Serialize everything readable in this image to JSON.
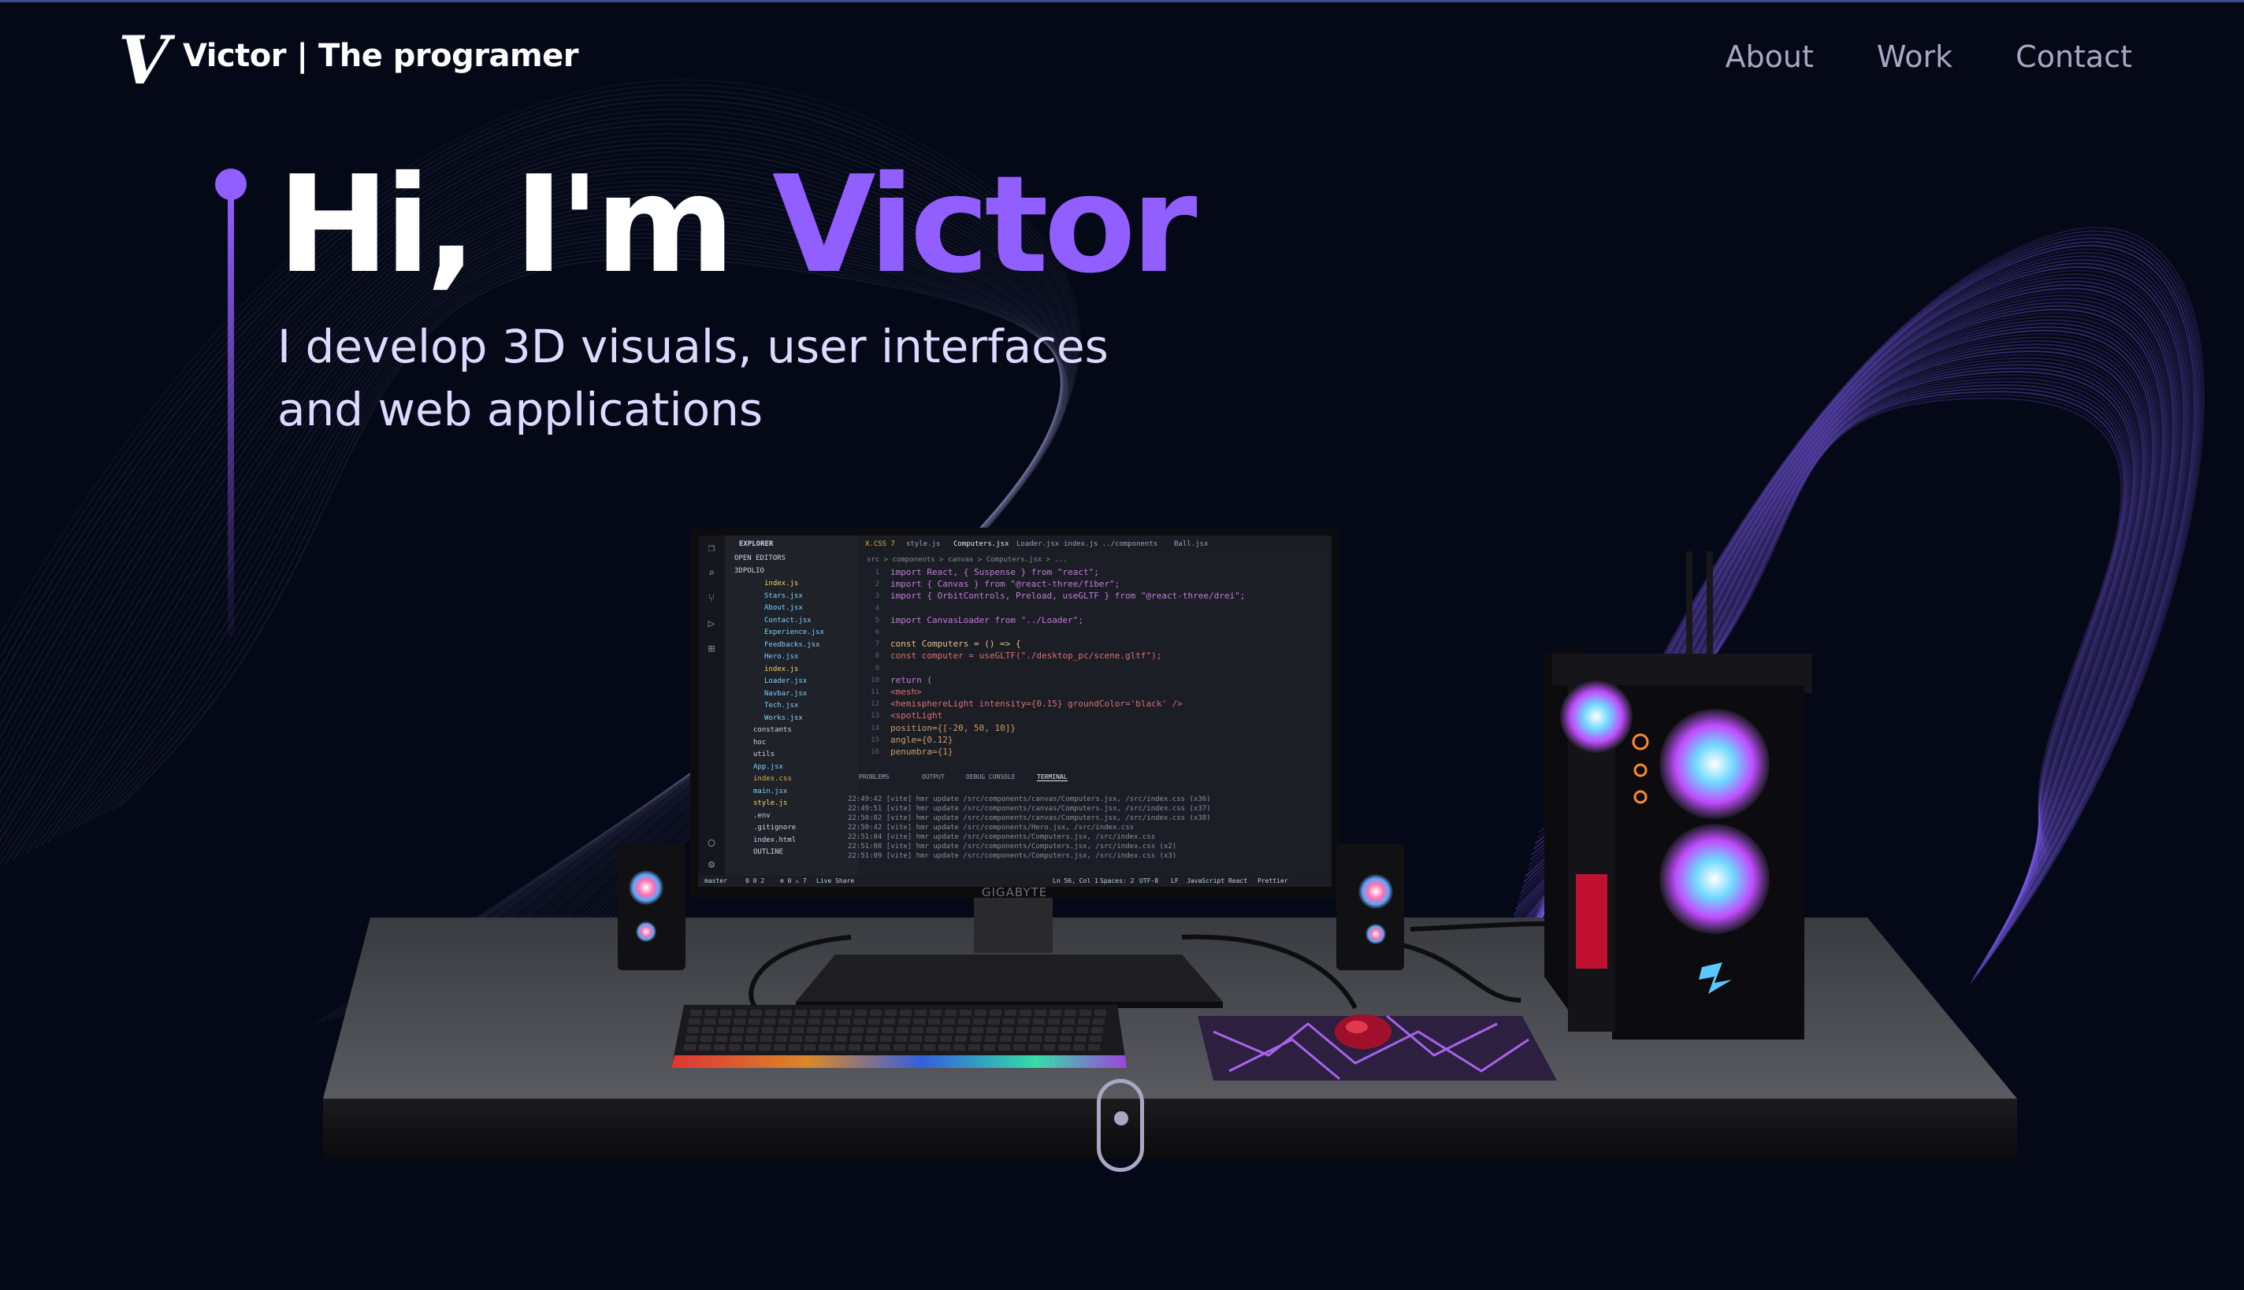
{
  "navbar": {
    "logo_letter": "V",
    "brand": "Victor  | The programer",
    "links": [
      "About",
      "Work",
      "Contact"
    ]
  },
  "hero": {
    "greeting": "Hi, I'm ",
    "name": "Victor",
    "subtitle": "I develop 3D visuals, user interfaces and web applications"
  },
  "monitor": {
    "brand": "GIGABYTE",
    "editor": {
      "explorer_title": "EXPLORER",
      "open_editors": "OPEN EDITORS",
      "project": "3DPOLIO",
      "tree": [
        "index.js",
        "Stars.jsx",
        "About.jsx",
        "Contact.jsx",
        "Experience.jsx",
        "Feedbacks.jsx",
        "Hero.jsx",
        "index.js",
        "Loader.jsx",
        "Navbar.jsx",
        "Tech.jsx",
        "Works.jsx",
        "constants",
        "hoc",
        "utils",
        "App.jsx",
        "index.css",
        "main.jsx",
        "style.js",
        ".env",
        ".gitignore",
        "index.html",
        "OUTLINE"
      ],
      "tabs": [
        "X.CSS 7",
        "style.js",
        "Computers.jsx",
        "Loader.jsx",
        "index.js ../components",
        "Ball.jsx"
      ],
      "breadcrumbs": "src > components > canvas > Computers.jsx > ...",
      "code": [
        "import React, { Suspense } from \"react\";",
        "import { Canvas } from \"@react-three/fiber\";",
        "import { OrbitControls, Preload, useGLTF } from \"@react-three/drei\";",
        "",
        "import CanvasLoader from \"../Loader\";",
        "",
        "const Computers = () => {",
        "  const computer = useGLTF(\"./desktop_pc/scene.gltf\");",
        "",
        "  return (",
        "    <mesh>",
        "      <hemisphereLight intensity={0.15} groundColor='black' />",
        "      <spotLight",
        "        position={[-20, 50, 10]}",
        "        angle={0.12}",
        "        penumbra={1}"
      ],
      "panel_tabs": [
        "PROBLEMS",
        "OUTPUT",
        "DEBUG CONSOLE",
        "TERMINAL"
      ],
      "terminal": [
        "22:49:42 [vite] hmr update /src/components/canvas/Computers.jsx, /src/index.css (x36)",
        "22:49:51 [vite] hmr update /src/components/canvas/Computers.jsx, /src/index.css (x37)",
        "22:50:02 [vite] hmr update /src/components/canvas/Computers.jsx, /src/index.css (x38)",
        "22:50:42 [vite] hmr update /src/components/Hero.jsx, /src/index.css",
        "22:51:04 [vite] hmr update /src/components/Computers.jsx, /src/index.css",
        "22:51:08 [vite] hmr update /src/components/Computers.jsx, /src/index.css (x2)",
        "22:51:09 [vite] hmr update /src/components/Computers.jsx, /src/index.css (x3)"
      ],
      "status_left": [
        "master",
        "0 0 2",
        "⊗ 0 ⚠ 7",
        "Live Share"
      ],
      "status_right": [
        "Ln 56, Col 1",
        "Spaces: 2",
        "UTF-8",
        "LF",
        "JavaScript React",
        "Prettier"
      ]
    }
  },
  "colors": {
    "background": "#050816",
    "accent": "#915eff",
    "nav_text": "#aaa6c3",
    "subtitle_text": "#dfd9ff"
  },
  "icons": [
    "scroll-indicator-icon",
    "explorer-icon",
    "search-icon",
    "source-control-icon",
    "debug-icon",
    "extensions-icon",
    "account-icon",
    "settings-icon"
  ]
}
